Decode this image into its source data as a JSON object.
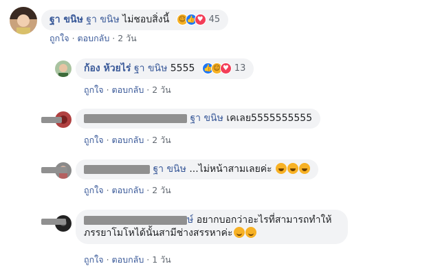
{
  "actions": {
    "like": "ถูกใจ",
    "reply": "ตอบกลับ",
    "sep": "·"
  },
  "comments": [
    {
      "author": "ฐา ขนิษ",
      "tag": "ฐา ขนิษ",
      "text": "ไม่ชอบสิ่งนี้",
      "reactions": [
        "haha",
        "like",
        "love"
      ],
      "reaction_count": "45",
      "time": "2 วัน"
    },
    {
      "author": "ก้อง ห้วยไร่",
      "tag": "ฐา ขนิษ",
      "text": "5555",
      "reactions": [
        "like",
        "haha",
        "love"
      ],
      "reaction_count": "13",
      "time": "2 วัน"
    },
    {
      "tag": "ฐา ขนิษ",
      "text": "เคเลย5555555555",
      "time": "2 วัน"
    },
    {
      "tag": "ฐา ขนิษ",
      "text": "...ไม่หน้าสามเลยค่ะ",
      "time": "2 วัน"
    },
    {
      "tag_tail": "ษ์",
      "line1": "อยากบอกว่าอะไรที่สามารถทำให้",
      "line2": "ภรรยาโมโหได้นั้นสามีช่างสรรหาค่ะ",
      "time": "1 วัน"
    }
  ],
  "colors": {
    "name_link": "#385898",
    "bubble_bg": "#f2f3f5",
    "meta_text": "#606770",
    "like_blue": "#2078f4",
    "love_red": "#f33e58",
    "haha_yellow": "#f7b125"
  }
}
